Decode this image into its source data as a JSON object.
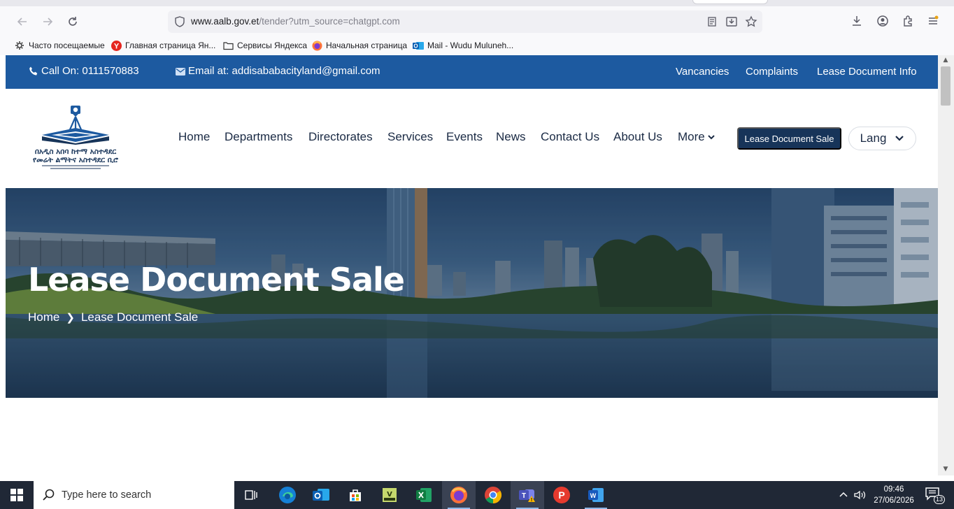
{
  "browser": {
    "url_host": "www.aalb.gov.et",
    "url_path": "/tender?utm_source=chatgpt.com",
    "bookmarks": [
      {
        "label": "Часто посещаемые",
        "icon": "gear-icon"
      },
      {
        "label": "Главная страница Ян...",
        "icon": "yandex-icon"
      },
      {
        "label": "Сервисы Яндекса",
        "icon": "folder-icon"
      },
      {
        "label": "Начальная страница",
        "icon": "firefox-icon"
      },
      {
        "label": "Mail - Wudu Muluneh...",
        "icon": "outlook-icon"
      }
    ]
  },
  "topbar": {
    "phone": "Call On: 0111570883",
    "email": "Email at: addisababacityland@gmail.com",
    "links": [
      "Vancancies",
      "Complaints",
      "Lease Document Info"
    ]
  },
  "logo": {
    "line1": "በአዲስ አበባ ከተማ አስተዳደር",
    "line2": "የመሬት ልማትና አስተዳደር ቢሮ"
  },
  "nav": {
    "items": [
      "Home",
      "Departments",
      "Directorates",
      "Services",
      "Events",
      "News",
      "Contact Us",
      "About Us",
      "More"
    ],
    "cta": "Lease Document Sale",
    "lang": "Lang"
  },
  "hero": {
    "title": "Lease Document Sale",
    "breadcrumb": [
      "Home",
      "Lease Document Sale"
    ]
  },
  "taskbar": {
    "search_placeholder": "Type here to search",
    "time": "09:46",
    "date": "27/06/2026",
    "notifications": "13",
    "apps": [
      "task-view-icon",
      "edge-icon",
      "outlook-icon",
      "store-icon",
      "app-icon",
      "excel-icon",
      "firefox-icon",
      "chrome-icon",
      "teams-icon",
      "psiphon-icon",
      "word-icon"
    ]
  },
  "colors": {
    "topbar": "#1d5aa0",
    "cta": "#173459",
    "nav_text": "#1a2a44",
    "taskbar": "#202836"
  }
}
